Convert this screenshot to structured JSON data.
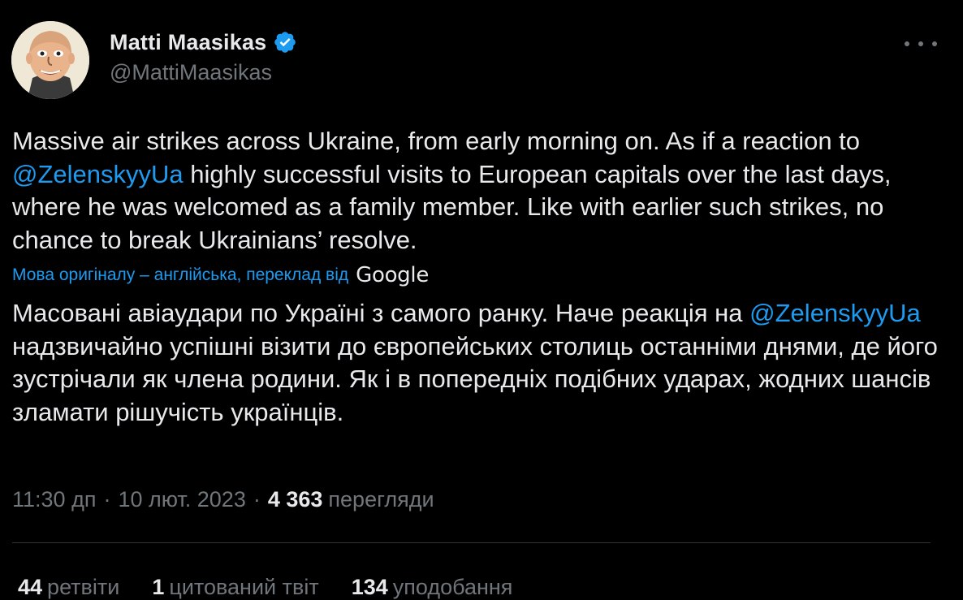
{
  "author": {
    "display_name": "Matti Maasikas",
    "handle": "@MattiMaasikas",
    "verified_icon": "verified-badge-icon"
  },
  "colors": {
    "background": "#000000",
    "text": "#e7e9ea",
    "muted": "#71767b",
    "accent": "#1d9bf0"
  },
  "tweet": {
    "text_part1": "Massive air strikes across Ukraine, from early morning on. As if a reaction to ",
    "mention": "@ZelenskyyUa",
    "text_part2": " highly successful visits to European capitals over the last days, where he was welcomed as a family member. Like with earlier such strikes, no chance to break Ukrainians’ resolve."
  },
  "translation": {
    "note": "Мова оригіналу – англійська, переклад від",
    "provider": "Google",
    "text_part1": "Масовані авіаудари по Україні з самого ранку. Наче реакція на ",
    "mention": "@ZelenskyyUa",
    "text_part2": " надзвичайно успішні візити до європейських столиць останніми днями, де його зустрічали як члена родини. Як і в попередніх подібних ударах, жодних шансів зламати рішучість українців."
  },
  "meta": {
    "time": "11:30 дп",
    "separator": "·",
    "date": "10 лют. 2023",
    "views_count": "4 363",
    "views_label": "перегляди"
  },
  "stats": {
    "retweets_count": "44",
    "retweets_label": "ретвіти",
    "quotes_count": "1",
    "quotes_label": "цитований твіт",
    "likes_count": "134",
    "likes_label": "уподобання"
  }
}
